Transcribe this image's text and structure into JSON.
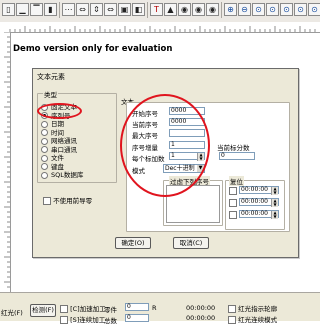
{
  "watermark": "Demo version only for evaluation",
  "colors": {
    "annotation": "#e0141e",
    "dialog_bg": "#ece9d8",
    "toolbar_bg": "#ece9e4"
  },
  "toolbar": {
    "icons": [
      "align-left-icon",
      "align-bottom-icon",
      "align-top-icon",
      "align-right-icon",
      "grid-icon",
      "distribute-icon",
      "distribute-vertical-icon",
      "distribute-horizontal-icon",
      "same-size-icon",
      "mirror-icon",
      "text-icon",
      "flip-icon",
      "eye-icon",
      "eye-icon",
      "eye-icon",
      "zoom-in-icon",
      "zoom-out-icon",
      "zoom-fit-icon",
      "zoom-icon",
      "zoom-icon",
      "zoom-icon",
      "zoom-icon"
    ]
  },
  "dialog": {
    "title": "文本元素",
    "type_group": {
      "label": "类型",
      "options": [
        "固定文本",
        "序列号",
        "日期",
        "时间",
        "网络通讯",
        "串口通讯",
        "文件",
        "键盘",
        "SQL数据库"
      ],
      "selected": "序列号"
    },
    "text_label": "文本",
    "serial": {
      "start_label": "开始序号",
      "start_value": "0000",
      "current_label": "当前序号",
      "current_value": "0000",
      "max_label": "最大序号",
      "max_value": "",
      "step_label": "序号增量",
      "step_value": "1",
      "repeat_label": "每个标加数",
      "repeat_value": "1",
      "mode_label": "模式",
      "mode_value": "Dec十进制"
    },
    "current_mark_label": "当前标分数",
    "current_mark_value": "0",
    "filter_label": "过虑下列序号",
    "reset_group": {
      "label": "复位",
      "times": [
        "00:00:00",
        "00:00:00",
        "00:00:00"
      ]
    },
    "no_wizard_label": "不使用前导零",
    "ok_label": "确定(O)",
    "cancel_label": "取消(C)"
  },
  "bottom": {
    "row1": {
      "left_label": "红光(F)",
      "detect_button": "检测(F)",
      "check1_label": "[C]加速加工",
      "parts_label": "零件",
      "parts_value": "0",
      "time1": "00:00:00",
      "time2": "00:00:00",
      "redlight_check": "红光指示轮廓"
    },
    "row2": {
      "check2_label": "[S]连续加工",
      "total_label": "总数",
      "total_value": "0",
      "redlight_mode": "红光连续模式"
    }
  }
}
